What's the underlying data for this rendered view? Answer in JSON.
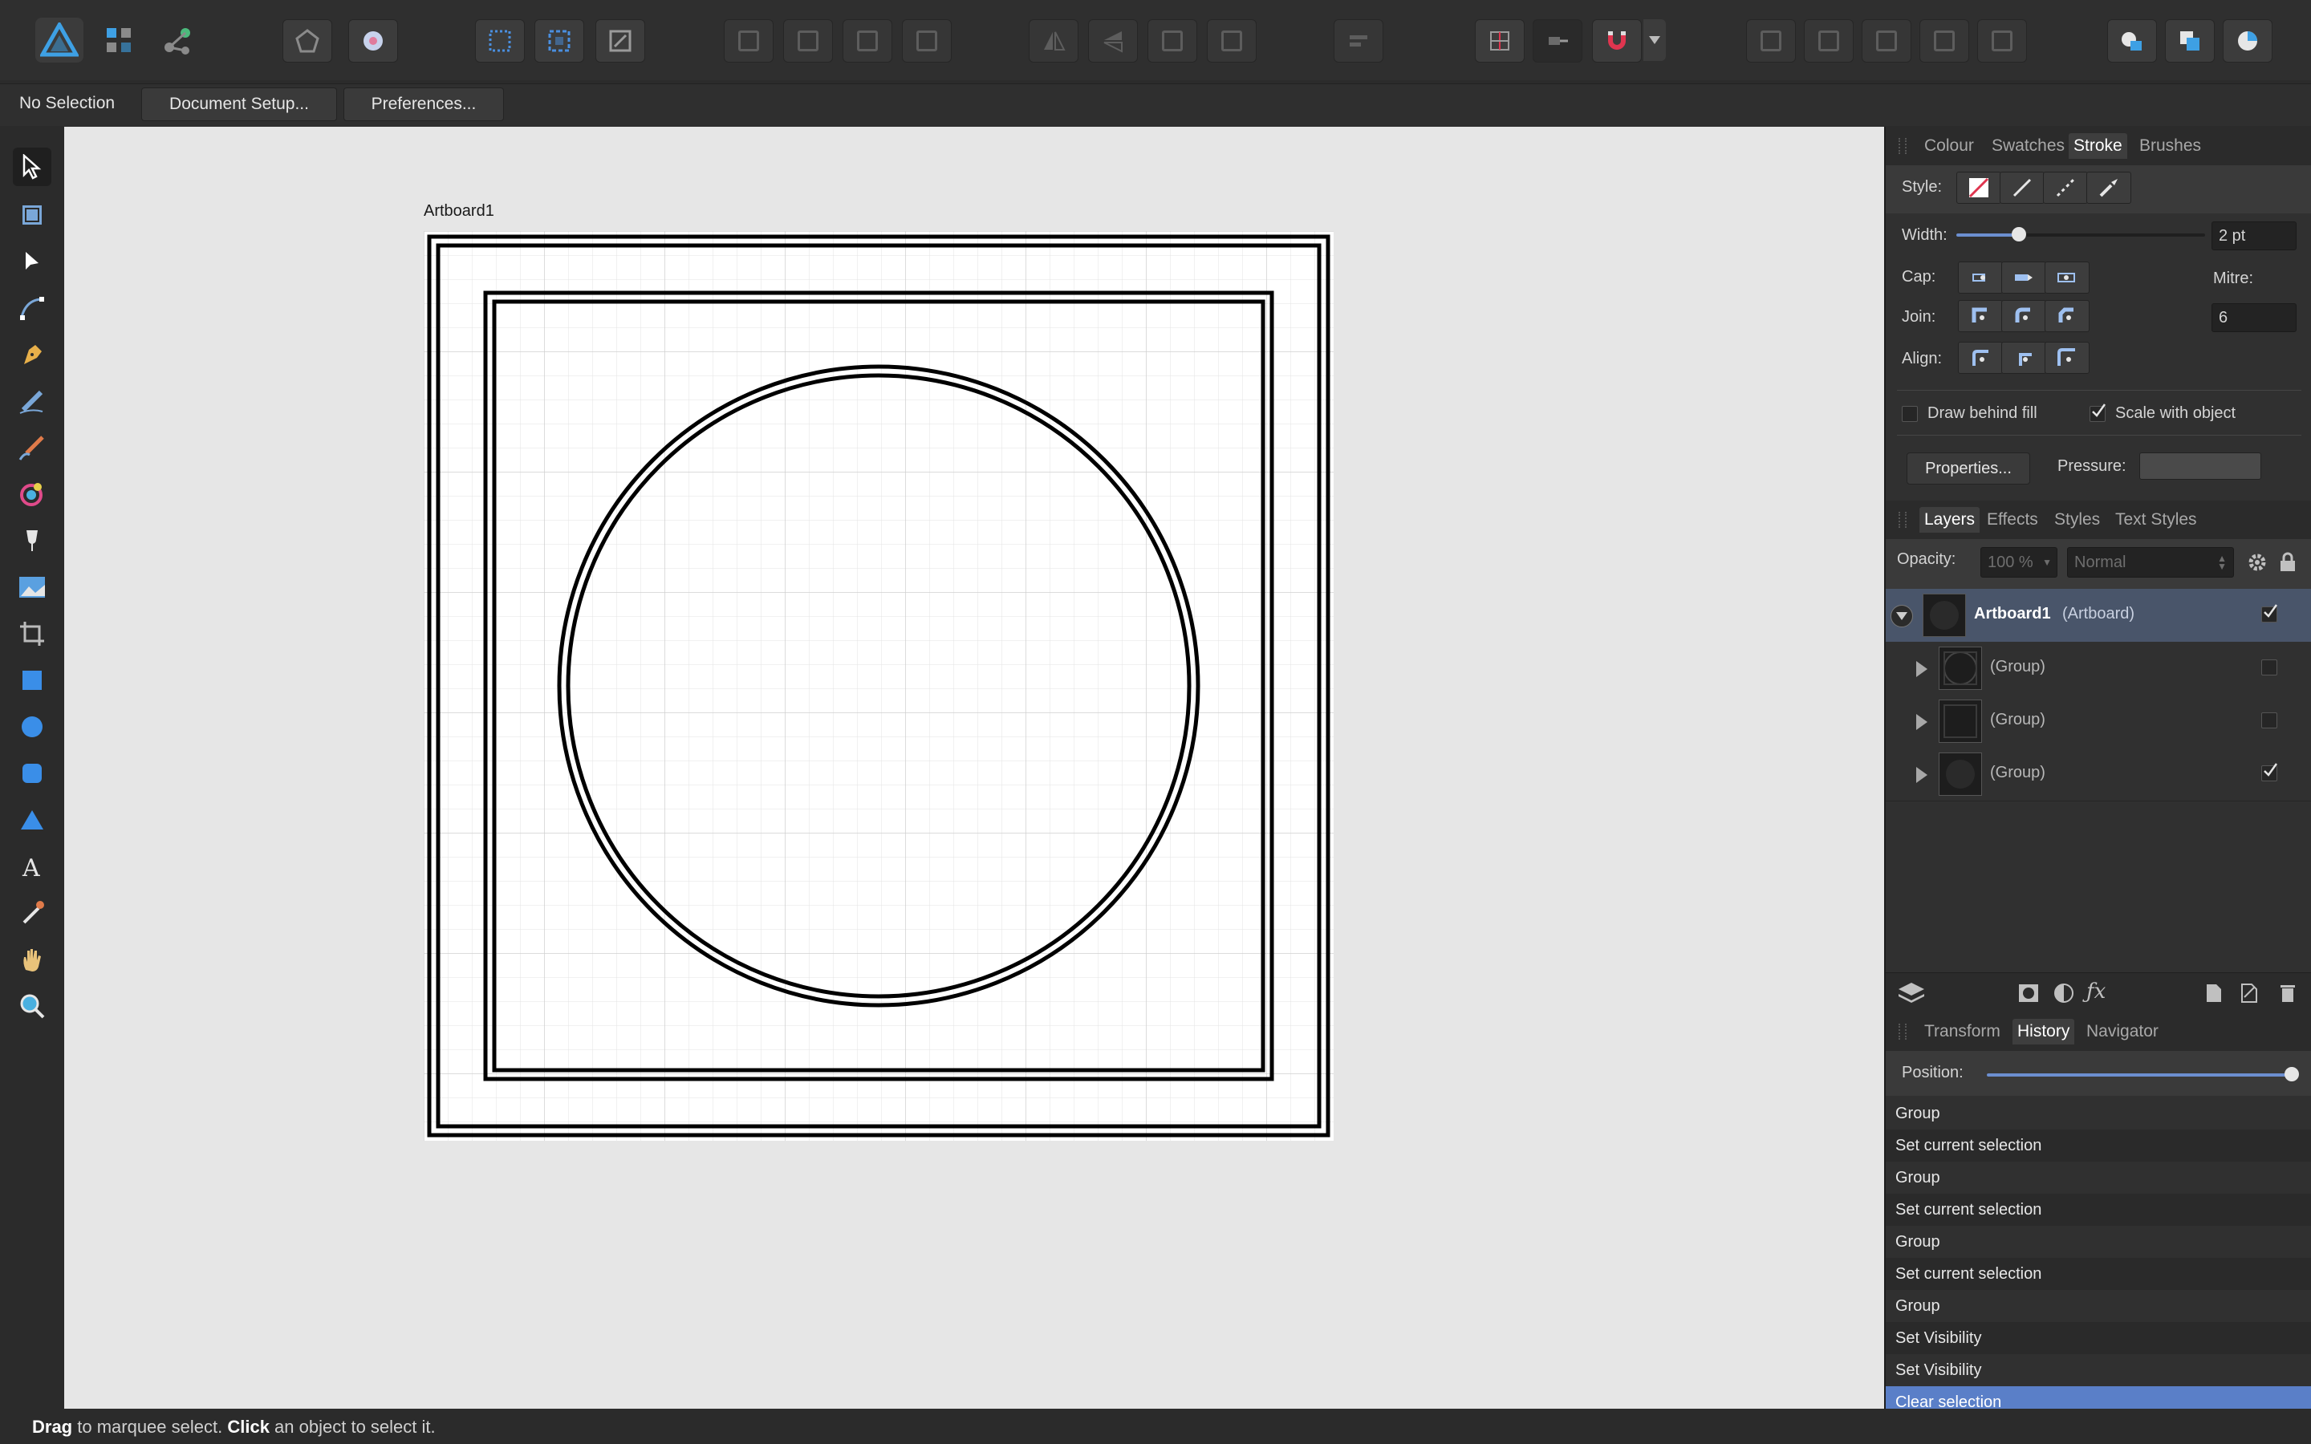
{
  "context_bar": {
    "selection_status": "No Selection",
    "document_setup_label": "Document Setup...",
    "preferences_label": "Preferences..."
  },
  "canvas": {
    "artboard_label": "Artboard1"
  },
  "status_bar": {
    "drag_word": "Drag",
    "drag_text": " to marquee select. ",
    "click_word": "Click",
    "click_text": " an object to select it."
  },
  "stroke_panel": {
    "tabs": [
      {
        "label": "Colour",
        "active": false
      },
      {
        "label": "Swatches",
        "active": false
      },
      {
        "label": "Stroke",
        "active": true
      },
      {
        "label": "Brushes",
        "active": false
      }
    ],
    "style_label": "Style:",
    "width_label": "Width:",
    "width_value": "2 pt",
    "width_slider_fraction": 0.25,
    "cap_label": "Cap:",
    "join_label": "Join:",
    "align_label": "Align:",
    "mitre_label": "Mitre:",
    "mitre_value": "6",
    "draw_behind_fill_label": "Draw behind fill",
    "draw_behind_fill_checked": false,
    "scale_with_object_label": "Scale with object",
    "scale_with_object_checked": true,
    "properties_label": "Properties...",
    "pressure_label": "Pressure:"
  },
  "layers_panel": {
    "tabs": [
      {
        "label": "Layers",
        "active": true
      },
      {
        "label": "Effects",
        "active": false
      },
      {
        "label": "Styles",
        "active": false
      },
      {
        "label": "Text Styles",
        "active": false
      }
    ],
    "opacity_label": "Opacity:",
    "opacity_value": "100 %",
    "blend_mode": "Normal",
    "layers": [
      {
        "name": "Artboard1",
        "kind": "(Artboard)",
        "selected": true,
        "visible": true
      },
      {
        "name": "",
        "kind": "(Group)",
        "selected": false,
        "visible": false
      },
      {
        "name": "",
        "kind": "(Group)",
        "selected": false,
        "visible": false
      },
      {
        "name": "",
        "kind": "(Group)",
        "selected": false,
        "visible": true
      }
    ]
  },
  "history_panel": {
    "tabs": [
      {
        "label": "Transform",
        "active": false
      },
      {
        "label": "History",
        "active": true
      },
      {
        "label": "Navigator",
        "active": false
      }
    ],
    "position_label": "Position:",
    "position_fraction": 1.0,
    "entries": [
      "Group",
      "Set current selection",
      "Group",
      "Set current selection",
      "Group",
      "Set current selection",
      "Group",
      "Set Visibility",
      "Set Visibility",
      "Clear selection"
    ],
    "selected_entry": "Clear selection"
  },
  "colors": {
    "accent": "#5a7fc8",
    "app_logo": "#3ea0e4",
    "snapping_magnet": "#e0354f",
    "canvas_bg": "#e6e6e6",
    "panel_bg": "#303030"
  }
}
